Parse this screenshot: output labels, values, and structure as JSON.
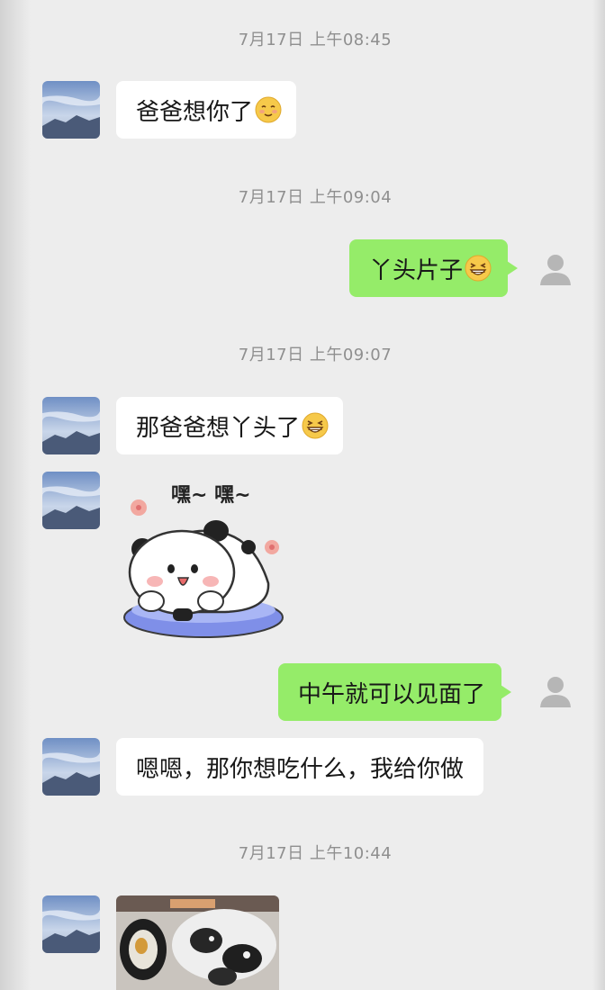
{
  "chat": {
    "timestamps": [
      "7月17日 上午08:45",
      "7月17日 上午09:04",
      "7月17日 上午09:07",
      "7月17日 上午10:44"
    ],
    "messages": {
      "m1": "爸爸想你了",
      "m2": "丫头片子",
      "m3": "那爸爸想丫头了",
      "m4_sticker_text": "嘿~ 嘿~",
      "m5": "中午就可以见面了",
      "m6": "嗯嗯，那你想吃什么，我给你做"
    },
    "icons": {
      "blushing_emoji": "smiling-face-closed-eyes",
      "grin_emoji": "grinning-face-squinting",
      "contact_avatar": "sky-mountain-photo",
      "my_avatar": "default-person-silhouette"
    },
    "colors": {
      "background": "#ededed",
      "sent_bubble": "#95ec69",
      "received_bubble": "#ffffff",
      "timestamp": "#8f8f8f"
    }
  }
}
